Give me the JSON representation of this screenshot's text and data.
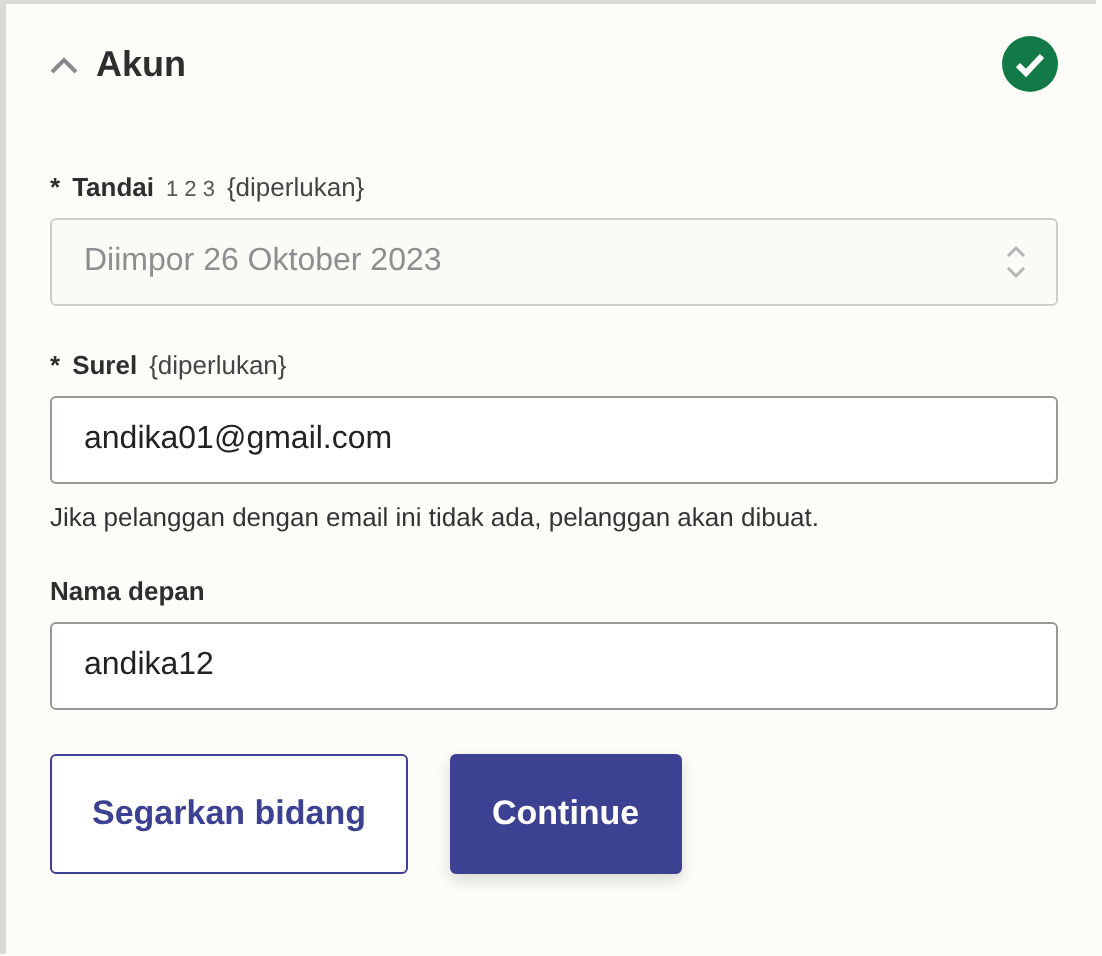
{
  "section": {
    "title": "Akun",
    "expanded": true,
    "complete": true
  },
  "fields": [
    {
      "kind": "select",
      "marker": "*",
      "label": "Tandai",
      "extra": "1 2 3",
      "note": "{diperlukan}",
      "value": "Diimpor 26 Oktober 2023",
      "disabled": true
    },
    {
      "kind": "text",
      "marker": "*",
      "label": "Surel",
      "note": "{diperlukan}",
      "value": "andika01@gmail.com",
      "disabled": false,
      "hint": "Jika pelanggan dengan email ini tidak ada, pelanggan akan dibuat."
    },
    {
      "kind": "text",
      "label": "Nama depan",
      "value": "andika12",
      "disabled": false
    }
  ],
  "buttons": [
    {
      "kind": "secondary",
      "label": "Segarkan bidang"
    },
    {
      "kind": "primary",
      "label": "Continue"
    }
  ]
}
